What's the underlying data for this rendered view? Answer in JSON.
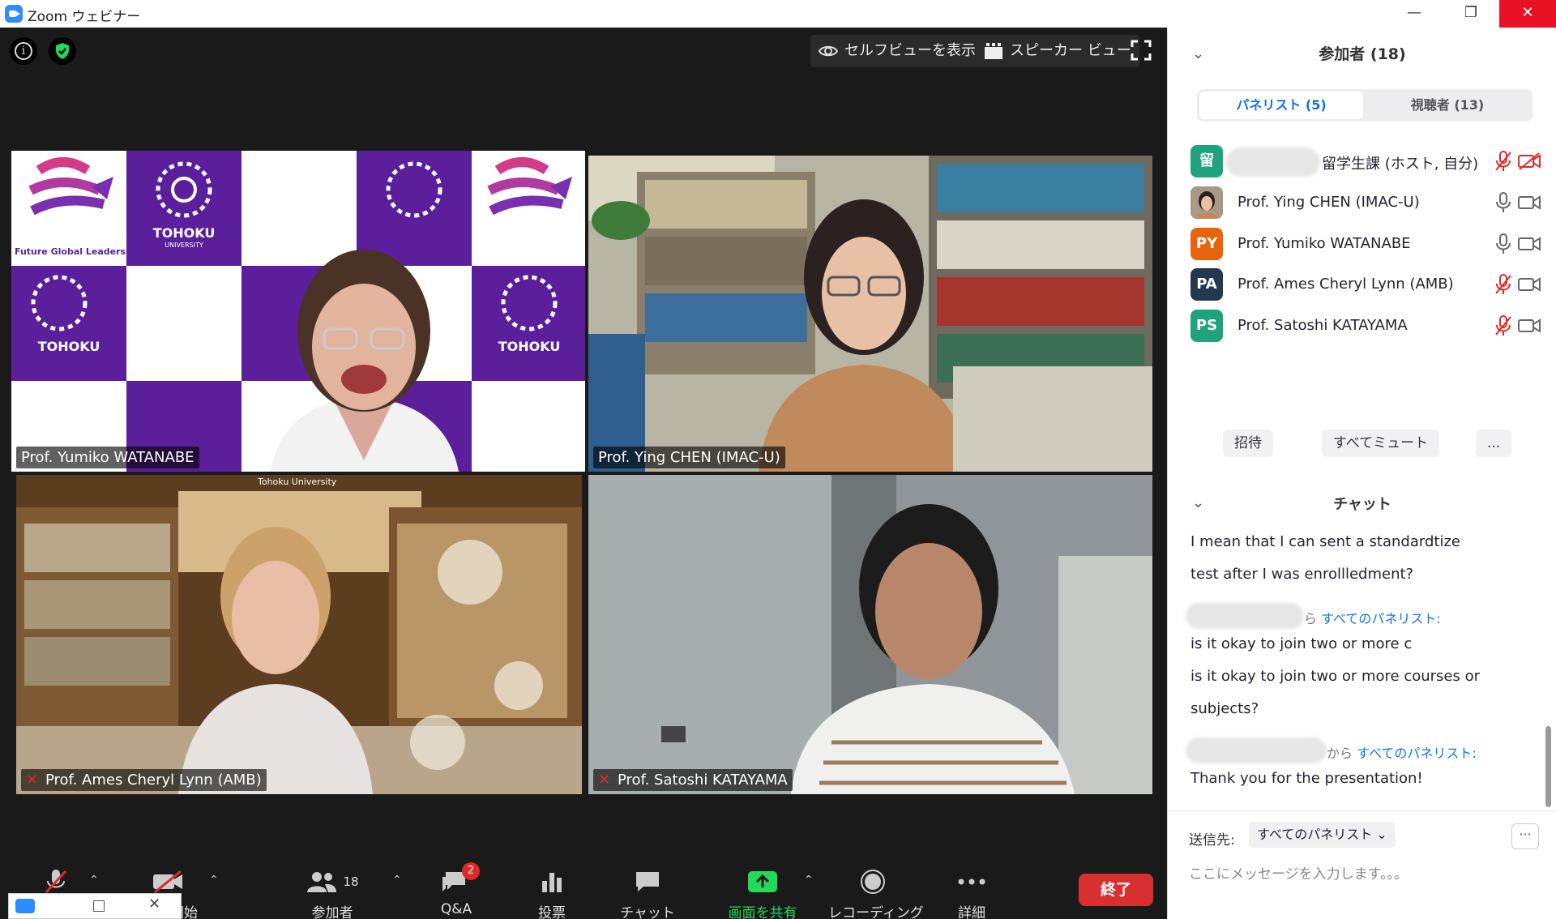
{
  "window": {
    "title": "Zoom ウェビナー",
    "minimize": "—",
    "restore": "❐",
    "close": "✕"
  },
  "top_controls": {
    "self_view": "セルフビューを表示",
    "speaker_view": "スピーカー ビュー"
  },
  "tiles": [
    {
      "name": "Prof. Yumiko WATANABE",
      "muted": false,
      "active": true,
      "backdrop": {
        "logo_text": "TOHOKU",
        "logo_sub": "UNIVERSITY",
        "slogan": "Future Global Leadership"
      }
    },
    {
      "name": "Prof. Ying CHEN (IMAC-U)",
      "muted": false,
      "active": false
    },
    {
      "name": "Prof. Ames Cheryl Lynn (AMB)",
      "muted": true,
      "active": false,
      "overlay_text": "Tohoku University"
    },
    {
      "name": "Prof. Satoshi KATAYAMA",
      "muted": true,
      "active": false
    }
  ],
  "toolbar": {
    "video_start": "開始",
    "participants_label": "参加者",
    "participants_count": "18",
    "qa_label": "Q&A",
    "qa_badge": "2",
    "poll_label": "投票",
    "chat_label": "チャット",
    "share_label": "画面を共有",
    "record_label": "レコーディング",
    "more_label": "詳細",
    "end_label": "終了"
  },
  "participants_panel": {
    "title": "参加者 (18)",
    "tab_panelists": "パネリスト (5)",
    "tab_attendees": "視聴者 (13)",
    "rows": [
      {
        "avatar": "留",
        "color": "#1fa37a",
        "name": "留学生課 (ホスト, 自分)",
        "mic_muted": true,
        "cam_off": true
      },
      {
        "avatar": "",
        "color": "#6b6b6b",
        "name": "Prof. Ying CHEN (IMAC-U)",
        "mic_muted": false,
        "cam_off": false
      },
      {
        "avatar": "PY",
        "color": "#e8640c",
        "name": "Prof. Yumiko WATANABE",
        "mic_muted": false,
        "cam_off": false
      },
      {
        "avatar": "PA",
        "color": "#24384f",
        "name": "Prof. Ames Cheryl Lynn (AMB)",
        "mic_muted": true,
        "cam_off": false
      },
      {
        "avatar": "PS",
        "color": "#1fa37a",
        "name": "Prof. Satoshi KATAYAMA",
        "mic_muted": true,
        "cam_off": false
      }
    ],
    "invite": "招待",
    "mute_all": "すべてミュート",
    "more": "..."
  },
  "chat": {
    "title": "チャット",
    "lines": [
      "I mean that I can sent a standardtize",
      "test after I was enrollledment?",
      "is it okay to join two or more c",
      "is it okay to join two or more courses or",
      "subjects?",
      "Thank you for the presentation!"
    ],
    "from_1_prefix": "ら",
    "from_2_prefix": "から",
    "to_panelists": "すべてのパネリスト:",
    "send_to_label": "送信先:",
    "send_to_value": "すべてのパネリスト ⌄",
    "more": "···",
    "input_placeholder": "ここにメッセージを入力します。。。"
  },
  "colors": {
    "accent": "#0e72ed",
    "end": "#d83030",
    "mute_red": "#e02828",
    "active_border": "#c8e63c",
    "brand_purple": "#5c1f9b"
  }
}
